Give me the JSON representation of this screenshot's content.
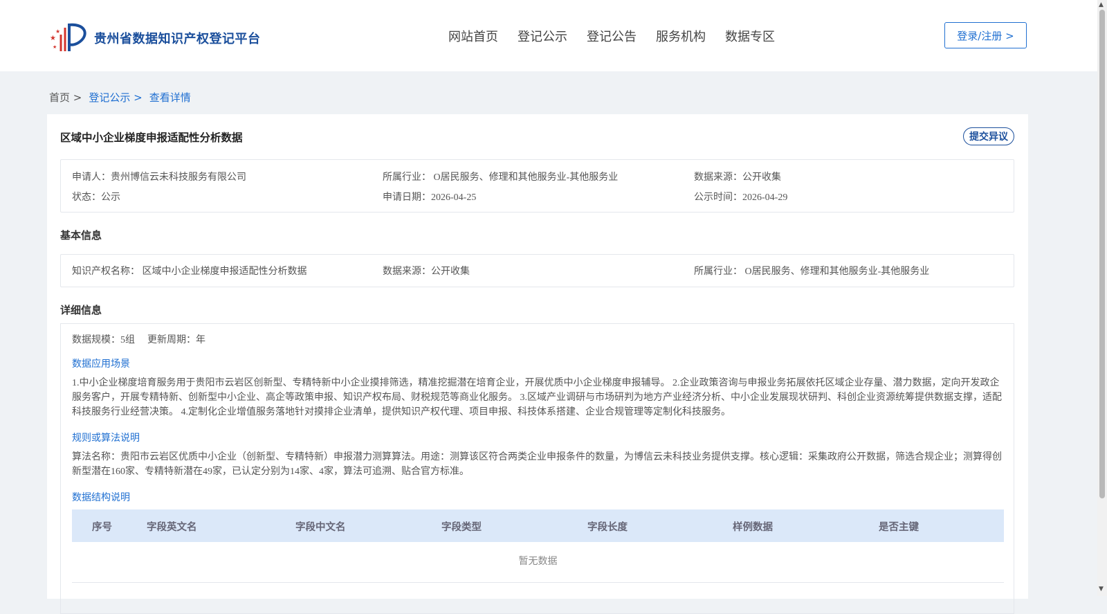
{
  "header": {
    "brand": "贵州省数据知识产权登记平台",
    "nav": [
      "网站首页",
      "登记公示",
      "登记公告",
      "服务机构",
      "数据专区"
    ],
    "login_label": "登录/注册 >"
  },
  "breadcrumb": {
    "home": "首页 >",
    "level1": "登记公示 >",
    "current": "查看详情"
  },
  "record": {
    "title": "区域中小企业梯度申报适配性分析数据",
    "objection_label": "提交异议",
    "summary": {
      "applicant": "申请人：贵州博信云未科技服务有限公司",
      "industry": "所属行业： O居民服务、修理和其他服务业-其他服务业",
      "source": "数据来源：公开收集",
      "status": "状态：公示",
      "apply_date": "申请日期：2026-04-25",
      "publish_date": "公示时间：2026-04-29"
    }
  },
  "basic_info": {
    "section_title": "基本信息",
    "ip_name": "知识产权名称： 区域中小企业梯度申报适配性分析数据",
    "source": "数据来源：公开收集",
    "industry": "所属行业： O居民服务、修理和其他服务业-其他服务业"
  },
  "detail_info": {
    "section_title": "详细信息",
    "scale": "数据规模：5组",
    "update_cycle": "更新周期：年",
    "scenario_title": "数据应用场景",
    "scenario_text": "1.中小企业梯度培育服务用于贵阳市云岩区创新型、专精特新中小企业摸排筛选，精准挖掘潜在培育企业，开展优质中小企业梯度申报辅导。 2.企业政策咨询与申报业务拓展依托区域企业存量、潜力数据，定向开发政企服务客户，开展专精特新、创新型中小企业、高企等政策申报、知识产权布局、财税规范等商业化服务。 3.区域产业调研与市场研判为地方产业经济分析、中小企业发展现状研判、科创企业资源统筹提供数据支撑，适配科技服务行业经营决策。 4.定制化企业增值服务落地针对摸排企业清单，提供知识产权代理、项目申报、科技体系搭建、企业合规管理等定制化科技服务。",
    "algorithm_title": "规则或算法说明",
    "algorithm_text": "算法名称：贵阳市云岩区优质中小企业（创新型、专精特新）申报潜力测算算法。用途：测算该区符合两类企业申报条件的数量，为博信云未科技业务提供支撑。核心逻辑：采集政府公开数据，筛选合规企业；测算得创新型潜在160家、专精特新潜在49家，已认定分别为14家、4家，算法可追溯、贴合官方标准。",
    "structure_title": "数据结构说明",
    "table_headers": [
      "序号",
      "字段英文名",
      "字段中文名",
      "字段类型",
      "字段长度",
      "样例数据",
      "是否主键"
    ],
    "empty_text": "暂无数据"
  }
}
